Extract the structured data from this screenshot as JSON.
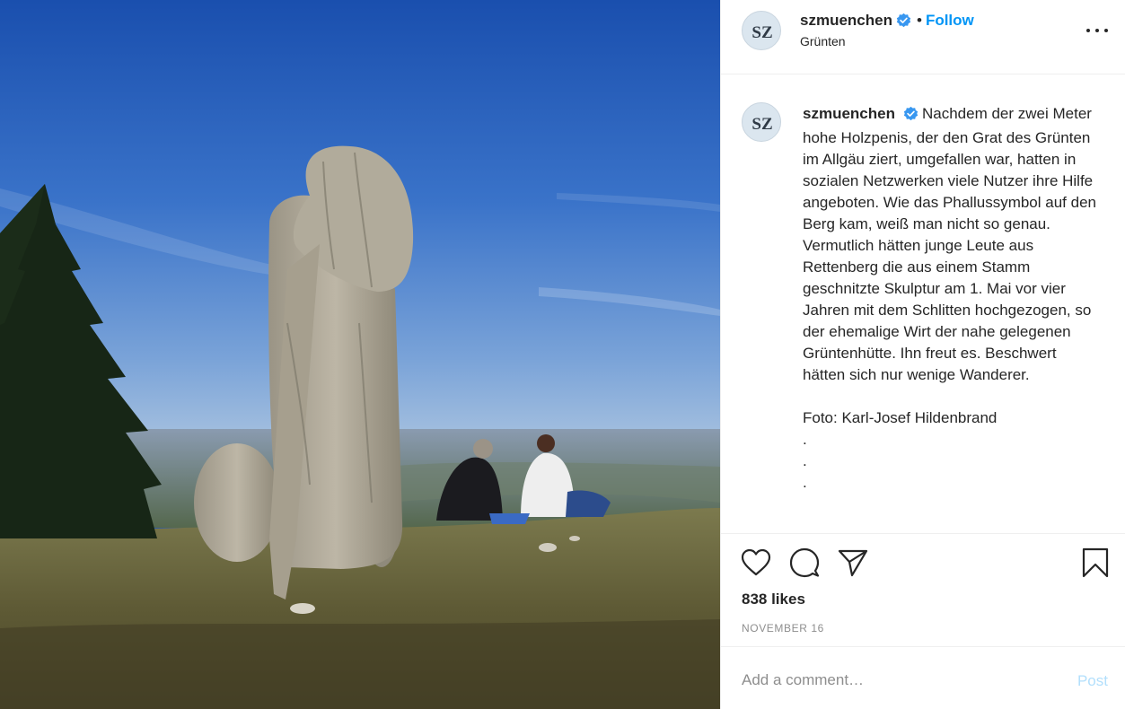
{
  "post": {
    "username": "szmuenchen",
    "verified": true,
    "follow_label": "Follow",
    "separator": "•",
    "location": "Grünten",
    "avatar_text": "SZ",
    "more_icon": "more-options-icon",
    "photo_alt": "Holzskulptur auf dem Grünten"
  },
  "caption": {
    "username": "szmuenchen",
    "text": "Nachdem der zwei Meter hohe Holzpenis, der den Grat des Grünten im Allgäu ziert, umgefallen war, hatten in sozialen Netzwerken viele Nutzer ihre Hilfe angeboten. Wie das Phallussymbol auf den Berg kam, weiß man nicht so genau. Vermutlich hätten junge Leute aus Rettenberg die aus einem Stamm geschnitzte Skulptur am 1. Mai vor vier Jahren mit dem Schlitten hochgezogen, so der ehemalige Wirt der nahe gelegenen Grüntenhütte. Ihn freut es. Beschwert hätten sich nur wenige Wanderer.",
    "credit": "Foto: Karl-Josef Hildenbrand",
    "dots": [
      ".",
      ".",
      "."
    ]
  },
  "actions": {
    "icons": [
      "heart-icon",
      "comment-icon",
      "share-icon",
      "bookmark-icon"
    ],
    "likes": "838 likes",
    "date": "NOVEMBER 16"
  },
  "comment_box": {
    "placeholder": "Add a comment…",
    "post_label": "Post"
  },
  "colors": {
    "link_blue": "#0095f6",
    "verified_blue": "#3897f0",
    "post_disabled": "#b2dffc",
    "muted_text": "#8e8e8e",
    "border": "#efefef"
  }
}
